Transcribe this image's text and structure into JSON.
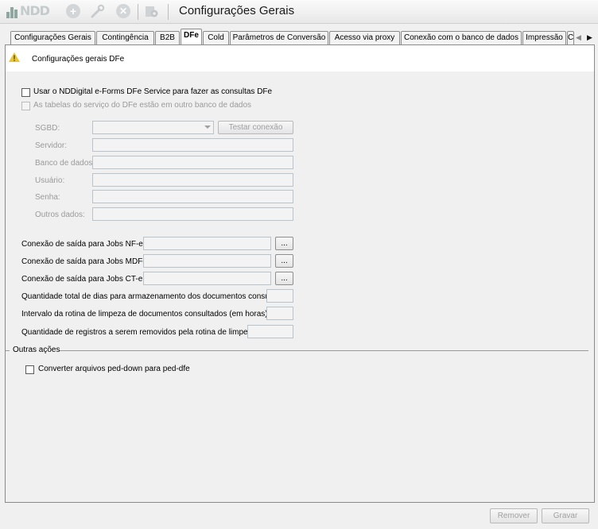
{
  "titlebar": {
    "logo_text": "NDD",
    "icons": [
      "add-icon",
      "wrench-icon",
      "cancel-icon",
      "settings-icon"
    ],
    "title": "Configurações Gerais"
  },
  "tabs": [
    {
      "label": "Configurações Gerais",
      "active": false
    },
    {
      "label": "Contingência",
      "active": false
    },
    {
      "label": "B2B",
      "active": false
    },
    {
      "label": "DFe",
      "active": true
    },
    {
      "label": "Cold",
      "active": false
    },
    {
      "label": "Parâmetros de Conversão",
      "active": false
    },
    {
      "label": "Acesso via proxy",
      "active": false
    },
    {
      "label": "Conexão com o banco de dados",
      "active": false
    },
    {
      "label": "Impressão",
      "active": false
    },
    {
      "label": "C",
      "active": false
    }
  ],
  "panel": {
    "title": "Configurações gerais DFe",
    "use_service_label": "Usar o NDDigital e-Forms DFe Service para fazer as consultas DFe",
    "use_service_checked": false,
    "other_db_label": "As tabelas do serviço do DFe estão em outro banco de dados",
    "other_db_checked": false,
    "db_fields": {
      "sgbd_label": "SGBD:",
      "sgbd_value": "",
      "test_button": "Testar conexão",
      "server_label": "Servidor:",
      "server_value": "",
      "database_label": "Banco de dados:",
      "database_value": "",
      "user_label": "Usuário:",
      "user_value": "",
      "password_label": "Senha:",
      "password_value": "",
      "other_label": "Outros dados:",
      "other_value": ""
    },
    "jobs": {
      "nfe_label": "Conexão de saída para Jobs NF-e:",
      "nfe_value": "",
      "mdfe_label": "Conexão de saída para Jobs MDF-e:",
      "mdfe_value": "",
      "cte_label": "Conexão de saída para Jobs CT-e:",
      "cte_value": "",
      "browse_label": "...",
      "days_label": "Quantidade total de dias para armazenamento dos documentos consultados:",
      "days_value": "",
      "interval_label": "Intervalo da rotina de limpeza de documentos consultados (em horas):",
      "interval_value": "",
      "records_label": "Quantidade de registros a serem removidos pela rotina de limpeza:",
      "records_value": ""
    },
    "other_actions": {
      "group_label": "Outras ações",
      "convert_label": "Converter arquivos ped-down para ped-dfe",
      "convert_checked": false
    }
  },
  "footer": {
    "remove_button": "Remover",
    "save_button": "Gravar"
  }
}
